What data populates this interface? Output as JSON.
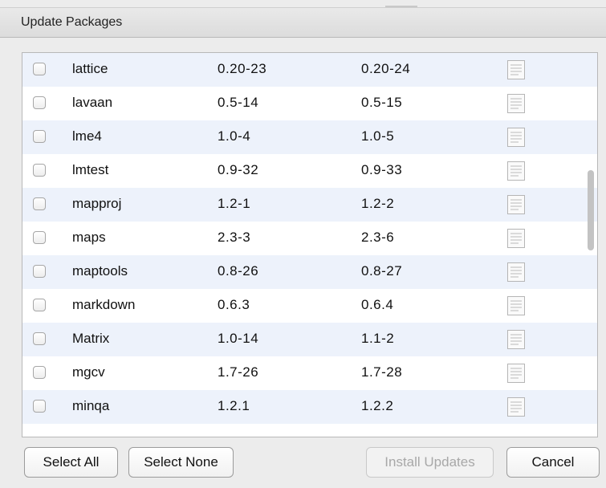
{
  "dialog": {
    "title": "Update Packages"
  },
  "packages": [
    {
      "name": "lattice",
      "installed": "0.20-23",
      "available": "0.20-24"
    },
    {
      "name": "lavaan",
      "installed": "0.5-14",
      "available": "0.5-15"
    },
    {
      "name": "lme4",
      "installed": "1.0-4",
      "available": "1.0-5"
    },
    {
      "name": "lmtest",
      "installed": "0.9-32",
      "available": "0.9-33"
    },
    {
      "name": "mapproj",
      "installed": "1.2-1",
      "available": "1.2-2"
    },
    {
      "name": "maps",
      "installed": "2.3-3",
      "available": "2.3-6"
    },
    {
      "name": "maptools",
      "installed": "0.8-26",
      "available": "0.8-27"
    },
    {
      "name": "markdown",
      "installed": "0.6.3",
      "available": "0.6.4"
    },
    {
      "name": "Matrix",
      "installed": "1.0-14",
      "available": "1.1-2"
    },
    {
      "name": "mgcv",
      "installed": "1.7-26",
      "available": "1.7-28"
    },
    {
      "name": "minqa",
      "installed": "1.2.1",
      "available": "1.2.2"
    }
  ],
  "row_icon": "news-document-icon",
  "buttons": {
    "select_all": "Select All",
    "select_none": "Select None",
    "install_updates": "Install Updates",
    "cancel": "Cancel"
  }
}
